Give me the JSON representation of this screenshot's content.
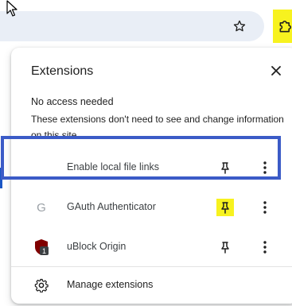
{
  "toolbar": {
    "bookmark_icon": "star-icon",
    "extensions_icon": "puzzle-icon",
    "highlight_color": "#f7f21f"
  },
  "popup": {
    "title": "Extensions",
    "close_icon": "close-icon",
    "section": {
      "heading": "No access needed",
      "description": "These extensions don't need to see and change information on this site."
    },
    "extensions": [
      {
        "name": "Enable local file links",
        "icon": "none",
        "pinned": false
      },
      {
        "name": "GAuth Authenticator",
        "icon": "g-letter-icon",
        "pinned": true,
        "highlighted": true
      },
      {
        "name": "uBlock Origin",
        "icon": "ublock-shield-icon",
        "pinned": false,
        "badge": "1"
      }
    ],
    "footer": {
      "label": "Manage extensions",
      "icon": "gear-icon"
    }
  },
  "colors": {
    "highlight_yellow": "#f7f21f",
    "selection_border": "#3b5bc7",
    "ublock_red": "#800000"
  }
}
